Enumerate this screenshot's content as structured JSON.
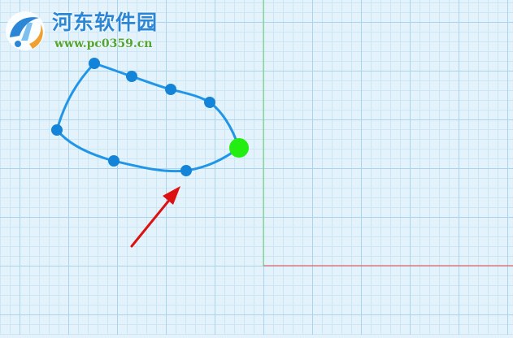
{
  "watermark": {
    "title": "河东软件园",
    "url": "www.pc0359.cn"
  },
  "colors": {
    "canvas_bg": "#e4f3fb",
    "grid_minor": "#cbe6f4",
    "grid_major": "#a9d4ec",
    "axis_x": "#e34a4a",
    "axis_y": "#6ad36a",
    "curve": "#2196e8",
    "control_point": "#1384d8",
    "active_point": "#22ee11",
    "arrow": "#dd1111",
    "watermark_blue": "#2b87d6",
    "watermark_green": "#53a430"
  },
  "icons": {
    "watermark_logo": "hedong-logo-icon",
    "pointer": "red-arrow-icon"
  }
}
